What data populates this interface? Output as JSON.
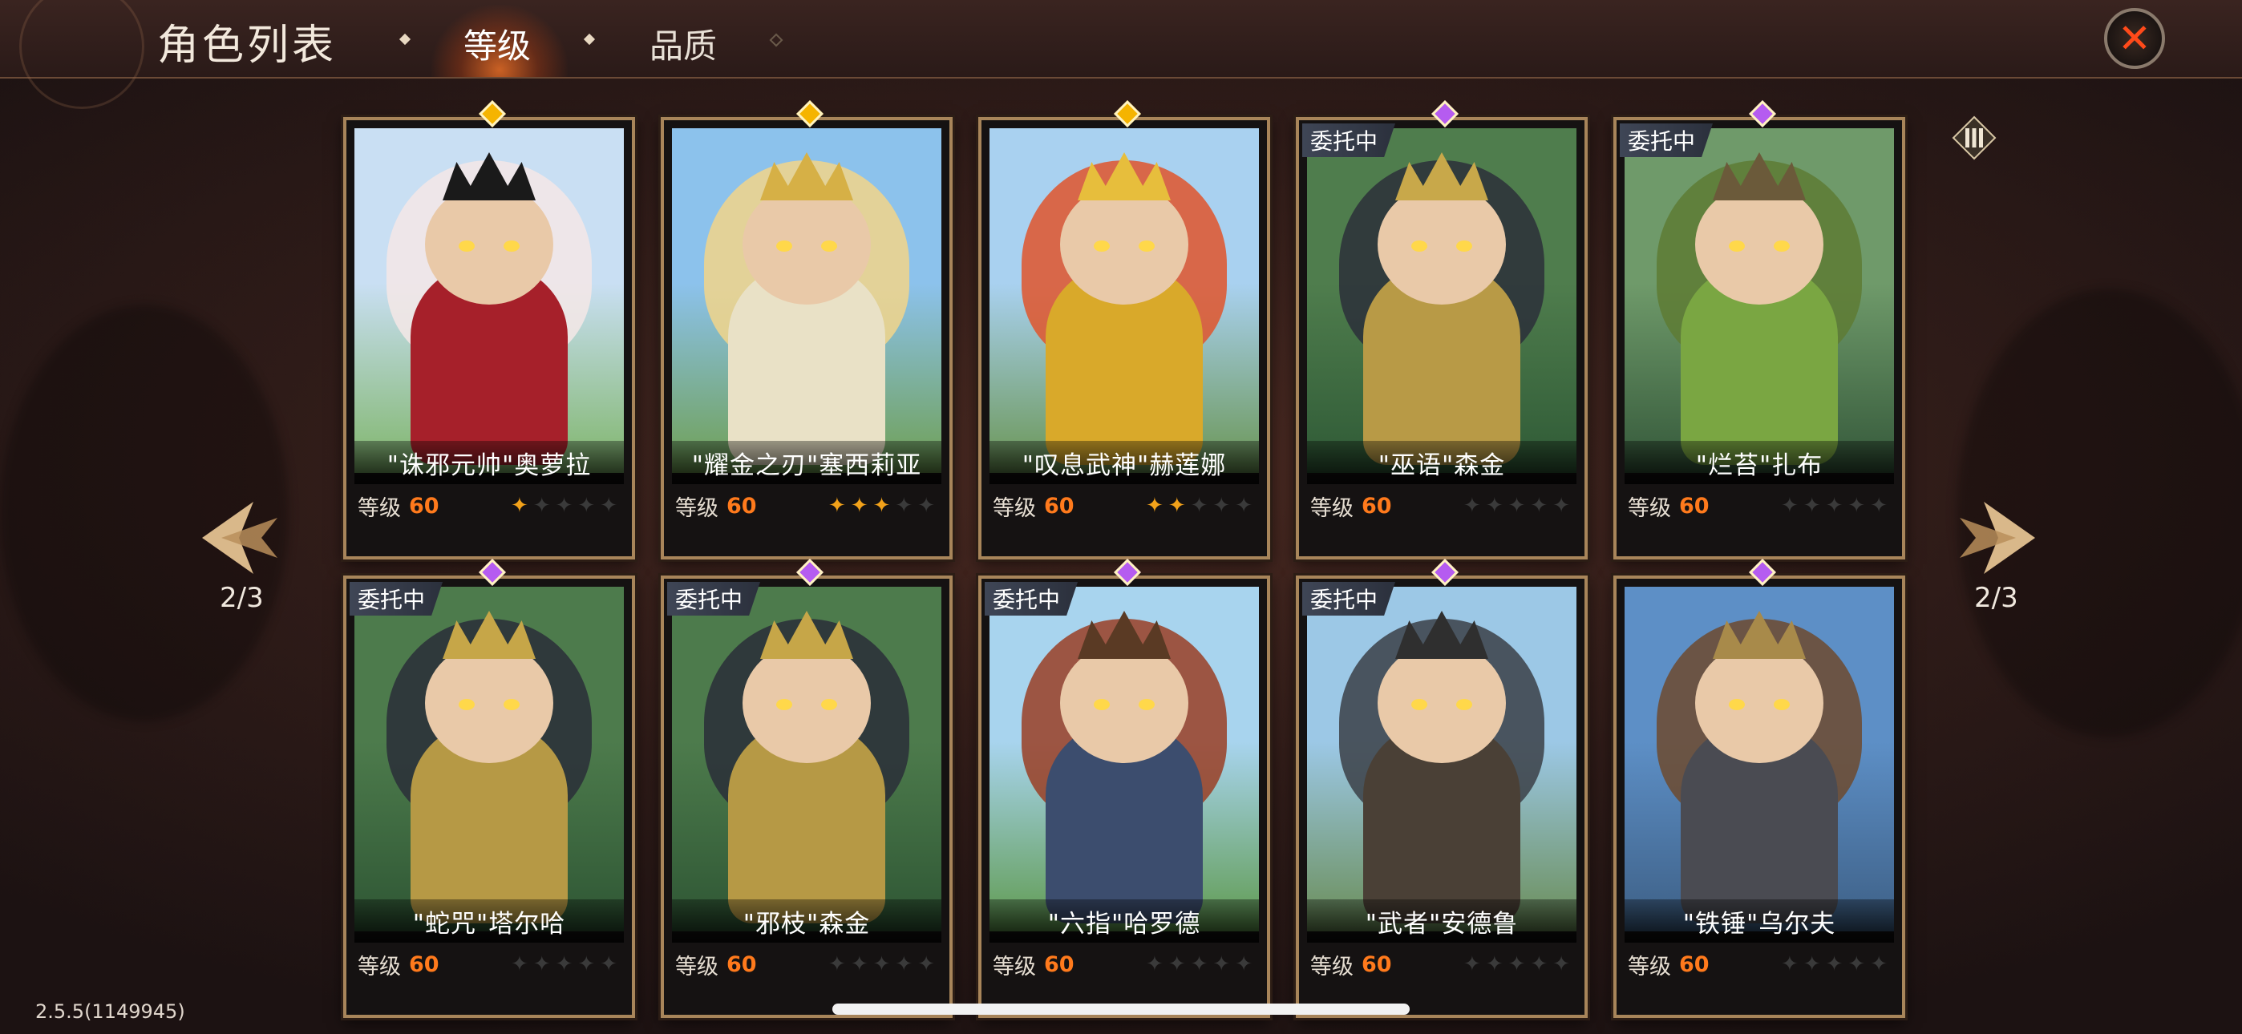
{
  "header": {
    "title": "角色列表",
    "tabs": [
      {
        "label": "等级",
        "active": true
      },
      {
        "label": "品质",
        "active": false
      }
    ]
  },
  "paging": {
    "left_label": "2/3",
    "right_label": "2/3"
  },
  "level_label": "等级",
  "cards": [
    {
      "name": "\"诛邪元帅\"奥萝拉",
      "level": "60",
      "stars": 1,
      "badge": "",
      "gem": "#f5b400",
      "palette": [
        "#c9dff3",
        "#7fb56a"
      ],
      "hair": "#f4e8e6",
      "body": "#a6202a",
      "crown": "#1a1a1a"
    },
    {
      "name": "\"耀金之刃\"塞西莉亚",
      "level": "60",
      "stars": 3,
      "badge": "",
      "gem": "#f5b400",
      "palette": [
        "#8cc2ec",
        "#6f9f52"
      ],
      "hair": "#f2d58a",
      "body": "#e9e1c6",
      "crown": "#d6b046"
    },
    {
      "name": "\"叹息武神\"赫莲娜",
      "level": "60",
      "stars": 2,
      "badge": "",
      "gem": "#f5b400",
      "palette": [
        "#a9d1f0",
        "#6a9553"
      ],
      "hair": "#e0552c",
      "body": "#d9a92a",
      "crown": "#e7be3c"
    },
    {
      "name": "\"巫语\"森金",
      "level": "60",
      "stars": 0,
      "badge": "委托中",
      "gem": "#b55cf0",
      "palette": [
        "#4f7d4d",
        "#2f5a36"
      ],
      "hair": "#2b2f3a",
      "body": "#b89a46",
      "crown": "#c8a84a"
    },
    {
      "name": "\"烂苔\"扎布",
      "level": "60",
      "stars": 0,
      "badge": "委托中",
      "gem": "#b55cf0",
      "palette": [
        "#6f9a6a",
        "#34583a"
      ],
      "hair": "#5e7b34",
      "body": "#7aa642",
      "crown": "#6b5a3a"
    },
    {
      "name": "\"蛇咒\"塔尔哈",
      "level": "60",
      "stars": 0,
      "badge": "委托中",
      "gem": "#b55cf0",
      "palette": [
        "#4d7b4c",
        "#2e5634"
      ],
      "hair": "#2a2e38",
      "body": "#b69945",
      "crown": "#c6a648"
    },
    {
      "name": "\"邪枝\"森金",
      "level": "60",
      "stars": 0,
      "badge": "委托中",
      "gem": "#b55cf0",
      "palette": [
        "#4d7b4c",
        "#2e5634"
      ],
      "hair": "#2a2e38",
      "body": "#b69945",
      "crown": "#c6a648"
    },
    {
      "name": "\"六指\"哈罗德",
      "level": "60",
      "stars": 0,
      "badge": "委托中",
      "gem": "#b55cf0",
      "palette": [
        "#a8d4ee",
        "#5f9a4e"
      ],
      "hair": "#9a3e24",
      "body": "#3c4d6e",
      "crown": "#5a3a24"
    },
    {
      "name": "\"武者\"安德鲁",
      "level": "60",
      "stars": 0,
      "badge": "委托中",
      "gem": "#b55cf0",
      "palette": [
        "#9cc8e6",
        "#6a8d56"
      ],
      "hair": "#3b3f46",
      "body": "#4a4036",
      "crown": "#2f2f2f"
    },
    {
      "name": "\"铁锤\"乌尔夫",
      "level": "60",
      "stars": 0,
      "badge": "",
      "gem": "#b55cf0",
      "palette": [
        "#5d8fc6",
        "#3d5f85"
      ],
      "hair": "#6d4a2e",
      "body": "#4a4b52",
      "crown": "#a88a4a"
    }
  ],
  "version": "2.5.5(1149945)",
  "icons": {
    "close": "close-icon",
    "grid": "grid-view-icon",
    "prev": "prev-page-arrow-icon",
    "next": "next-page-arrow-icon"
  }
}
